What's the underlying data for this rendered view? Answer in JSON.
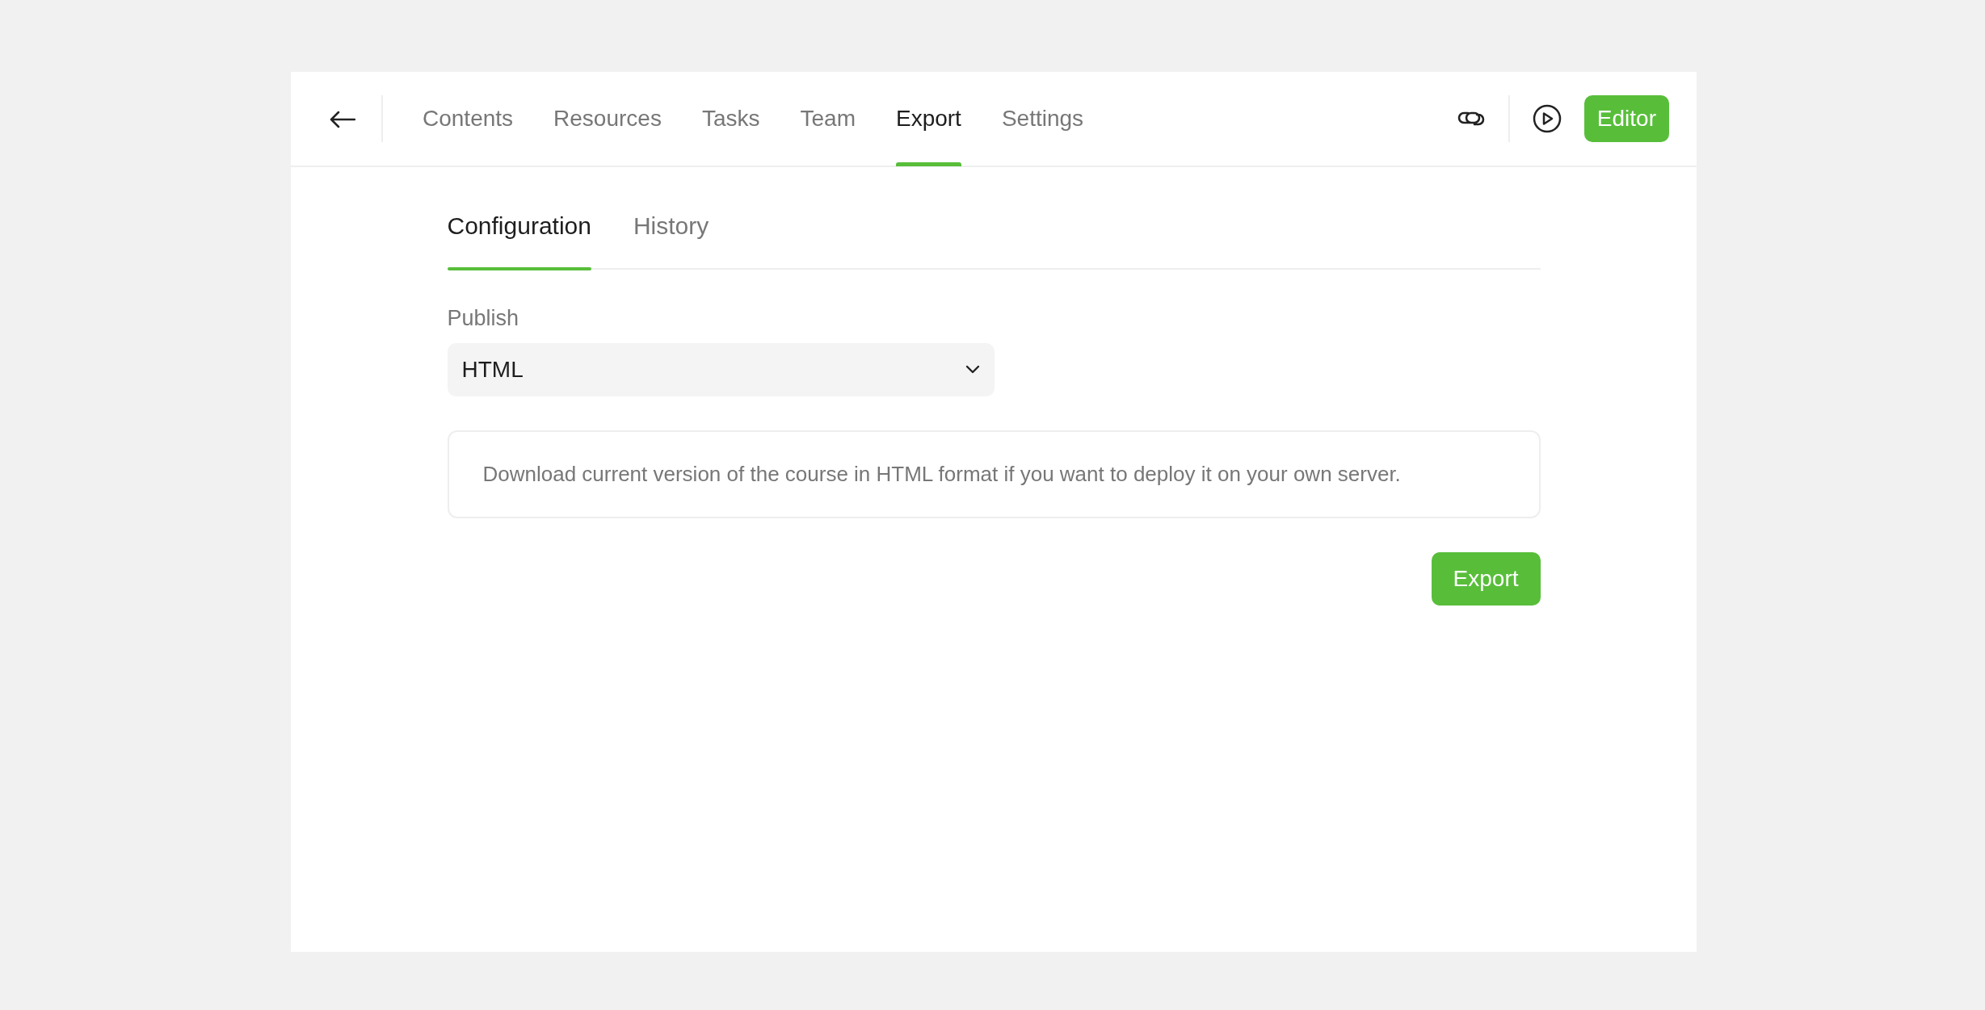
{
  "header": {
    "nav": [
      {
        "label": "Contents",
        "selected": false
      },
      {
        "label": "Resources",
        "selected": false
      },
      {
        "label": "Tasks",
        "selected": false
      },
      {
        "label": "Team",
        "selected": false
      },
      {
        "label": "Export",
        "selected": true
      },
      {
        "label": "Settings",
        "selected": false
      }
    ],
    "editor_button": "Editor"
  },
  "subtabs": [
    {
      "label": "Configuration",
      "selected": true
    },
    {
      "label": "History",
      "selected": false
    }
  ],
  "publish": {
    "label": "Publish",
    "value": "HTML"
  },
  "description": "Download current version of the course in HTML format if you want to deploy it on your own server.",
  "export_button": "Export"
}
